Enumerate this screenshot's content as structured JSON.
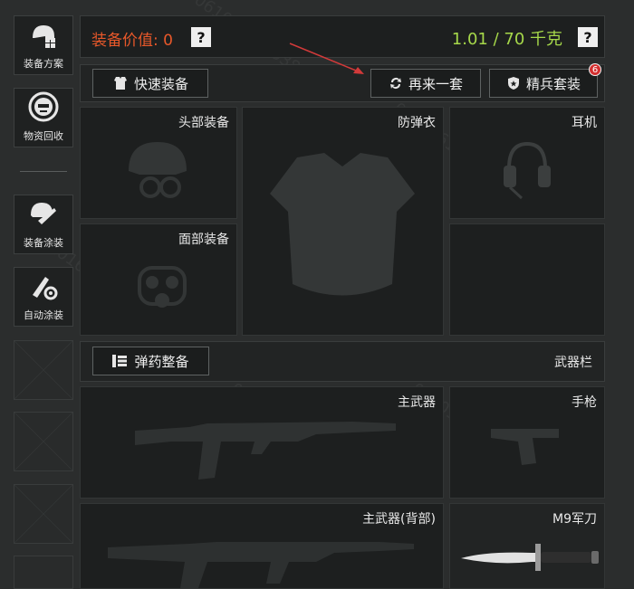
{
  "rail": {
    "loadout_plans": "装备方案",
    "recycle": "物资回收",
    "skins": "装备涂装",
    "auto_skin": "自动涂装"
  },
  "header": {
    "value_label": "装备价值: 0",
    "weight": "1.01 / 70 千克",
    "help": "?",
    "value_color": "#e8582a",
    "weight_color": "#a6d84a"
  },
  "toolbar": {
    "quick_equip": "快速装备",
    "another_set": "再来一套",
    "elite_set": "精兵套装",
    "elite_badge": "6"
  },
  "slots": {
    "head": "头部装备",
    "armor": "防弹衣",
    "headset": "耳机",
    "face": "面部装备",
    "primary": "主武器",
    "pistol": "手枪",
    "primary_back": "主武器(背部)",
    "melee": "M9军刀"
  },
  "ammo": {
    "button": "弹药整备",
    "weapon_bar": "武器栏"
  },
  "watermark": "0610161013380553"
}
